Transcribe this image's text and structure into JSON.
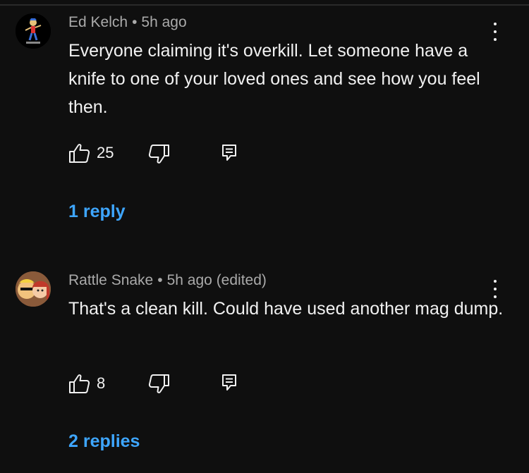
{
  "comments": [
    {
      "author": "Ed Kelch",
      "separator": "•",
      "timestamp": "5h ago",
      "edited": "",
      "text": "Everyone claiming it's overkill. Let someone have a knife to one of your loved ones and see how you feel then.",
      "likes": "25",
      "replies": "1 reply"
    },
    {
      "author": "Rattle Snake",
      "separator": "•",
      "timestamp": "5h ago",
      "edited": "(edited)",
      "text": "That's a clean kill. Could have used another mag dump.",
      "likes": "8",
      "replies": "2 replies"
    }
  ],
  "icons": {
    "like": "thumbs-up-icon",
    "dislike": "thumbs-down-icon",
    "reply": "reply-comment-icon",
    "menu": "more-vertical-icon"
  },
  "colors": {
    "background": "#0f0f0f",
    "text": "#f1f1f1",
    "meta": "#aaaaaa",
    "link": "#3ea6ff"
  }
}
